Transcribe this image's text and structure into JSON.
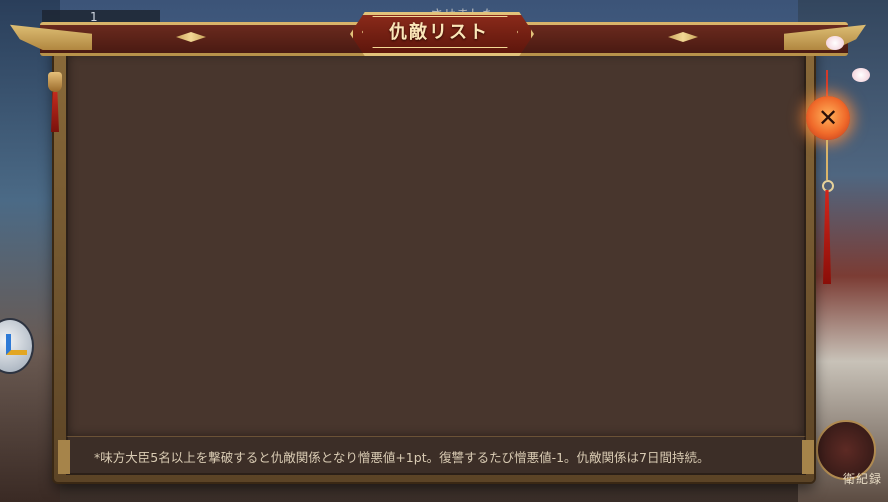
{
  "background": {
    "top_left_counter": "1",
    "top_notice": "させました",
    "right_badge_text": "衛紀録"
  },
  "dialog": {
    "title": "仇敵リスト",
    "close_symbol": "✕",
    "footer_note": "*味方大臣5名以上を撃破すると仇敵関係となり憎悪値+1pt。復讐するたび憎悪値-1。仇敵関係は7日間持続。",
    "enemy_list": []
  },
  "colors": {
    "panel_bg": "#48362d",
    "title_plate": "#7a2416",
    "gold_trim": "#d9b46a",
    "close_glow": "#f06a2a"
  }
}
